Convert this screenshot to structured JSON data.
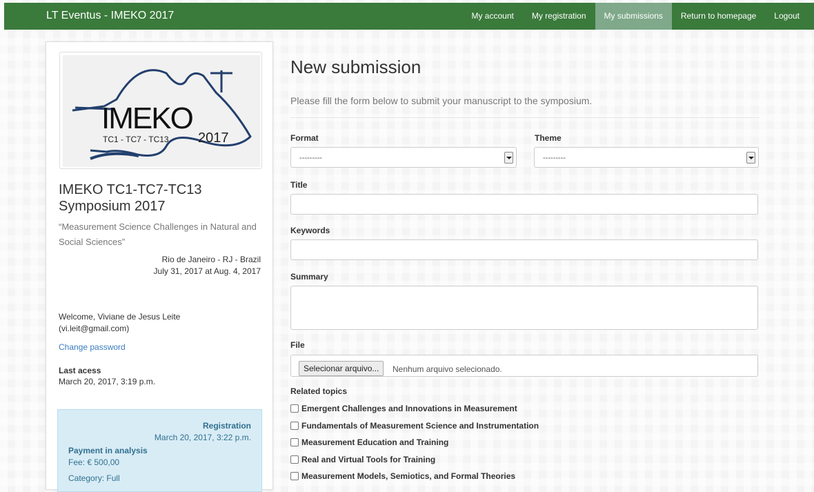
{
  "navbar": {
    "brand": "LT Eventus - IMEKO 2017",
    "links": [
      {
        "label": "My account"
      },
      {
        "label": "My registration"
      },
      {
        "label": "My submissions"
      },
      {
        "label": "Return to homepage"
      },
      {
        "label": "Logout"
      }
    ],
    "active_index": 2,
    "bg_color": "#3a7a3b"
  },
  "sidebar": {
    "logo": {
      "word": "IMEKO",
      "committees": "TC1 - TC7 - TC13",
      "year": "2017"
    },
    "conference_title": "IMEKO TC1-TC7-TC13 Symposium 2017",
    "conference_subtitle": "“Measurement Science Challenges in Natural and Social Sciences”",
    "location": "Rio de Janeiro - RJ - Brazil",
    "dates": "July 31, 2017 at Aug. 4, 2017",
    "welcome": "Welcome, Viviane de Jesus Leite (vi.leit@gmail.com)",
    "change_password": "Change password",
    "last_access_label": "Last acess",
    "last_access_value": "March 20, 2017, 3:19 p.m.",
    "registration": {
      "title": "Registration",
      "date": "March 20, 2017, 3:22 p.m.",
      "status": "Payment in analysis",
      "fee": "Fee: € 500,00",
      "category": "Category: Full"
    }
  },
  "main": {
    "title": "New submission",
    "intro": "Please fill the form below to submit your manuscript to the symposium.",
    "format_label": "Format",
    "format_value": "---------",
    "theme_label": "Theme",
    "theme_value": "---------",
    "title_label": "Title",
    "keywords_label": "Keywords",
    "summary_label": "Summary",
    "file_label": "File",
    "file_button": "Selecionar arquivo...",
    "file_status": "Nenhum arquivo selecionado.",
    "related_label": "Related topics",
    "topics": [
      "Emergent Challenges and Innovations in Measurement",
      "Fundamentals of Measurement Science and Instrumentation",
      "Measurement Education and Training",
      "Real and Virtual Tools for Training",
      "Measurement Models, Semiotics, and Formal Theories"
    ]
  }
}
